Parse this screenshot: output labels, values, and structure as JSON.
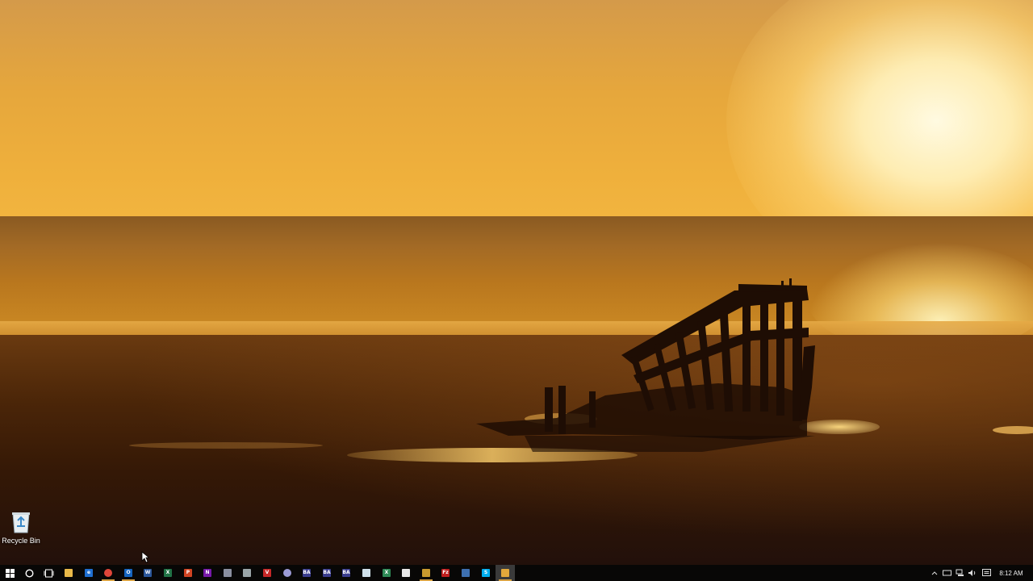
{
  "desktop": {
    "icons": [
      {
        "label": "Recycle Bin",
        "icon": "recycle-bin-icon"
      }
    ]
  },
  "taskbar": {
    "start_icon": "windows-logo-icon",
    "search_icon": "cortana-circle-icon",
    "task_view_icon": "task-view-icon",
    "apps": [
      {
        "icon": "file-explorer-icon",
        "glyph": "",
        "color": "#e9b949"
      },
      {
        "icon": "edge-icon",
        "glyph": "e",
        "color": "#1f6fd1"
      },
      {
        "icon": "chrome-icon",
        "glyph": "",
        "color": "#e0463a"
      },
      {
        "icon": "outlook-icon",
        "glyph": "O",
        "color": "#1565c0"
      },
      {
        "icon": "word-icon",
        "glyph": "W",
        "color": "#2b579a"
      },
      {
        "icon": "excel-icon",
        "glyph": "X",
        "color": "#217346"
      },
      {
        "icon": "powerpoint-icon",
        "glyph": "P",
        "color": "#d04423"
      },
      {
        "icon": "onenote-icon",
        "glyph": "N",
        "color": "#7719aa"
      },
      {
        "icon": "snipping-tool-icon",
        "glyph": "",
        "color": "#8a8fa0"
      },
      {
        "icon": "paint-icon",
        "glyph": "",
        "color": "#9aa5a8"
      },
      {
        "icon": "antivirus-icon",
        "glyph": "V",
        "color": "#c62828"
      },
      {
        "icon": "browser-icon",
        "glyph": "",
        "color": "#9b9bd6"
      },
      {
        "icon": "app-ba-1-icon",
        "glyph": "BA",
        "color": "#3b3e8f"
      },
      {
        "icon": "app-ba-2-icon",
        "glyph": "BA",
        "color": "#3b3e8f"
      },
      {
        "icon": "app-ba-3-icon",
        "glyph": "BA",
        "color": "#3b3e8f"
      },
      {
        "icon": "notepad-icon",
        "glyph": "",
        "color": "#cfe0ea"
      },
      {
        "icon": "excel-file-icon",
        "glyph": "X",
        "color": "#2f8a57"
      },
      {
        "icon": "document-icon",
        "glyph": "",
        "color": "#e8e8e8"
      },
      {
        "icon": "tools-icon",
        "glyph": "",
        "color": "#c99a2e"
      },
      {
        "icon": "filezilla-icon",
        "glyph": "Fz",
        "color": "#bf1e1e"
      },
      {
        "icon": "remote-desktop-icon",
        "glyph": "",
        "color": "#3d6fb0"
      },
      {
        "icon": "skype-icon",
        "glyph": "S",
        "color": "#00aff0"
      },
      {
        "icon": "settings-gear-icon",
        "glyph": "",
        "color": "#e2a83b"
      }
    ],
    "tray": {
      "chevron_icon": "show-hidden-icons-chevron-icon",
      "network_icon": "network-icon",
      "speaker_icon": "speaker-icon",
      "notification_icon": "action-center-icon",
      "clock": "8:12 AM"
    }
  }
}
